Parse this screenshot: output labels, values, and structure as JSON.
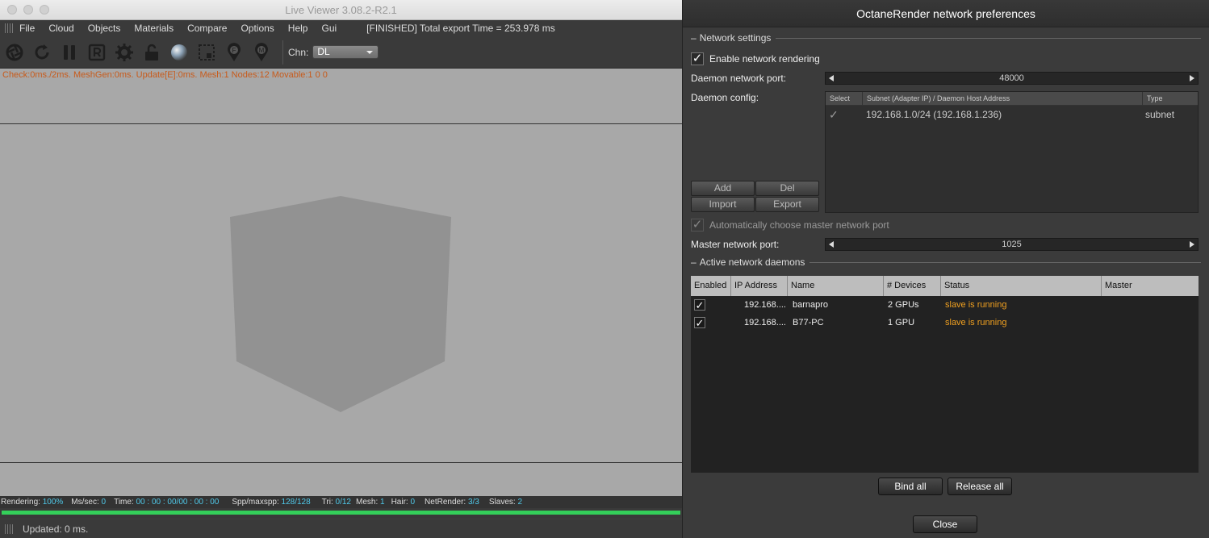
{
  "viewer": {
    "title": "Live Viewer 3.08.2-R2.1",
    "menu": [
      "File",
      "Cloud",
      "Objects",
      "Materials",
      "Compare",
      "Options",
      "Help",
      "Gui"
    ],
    "export_status": "[FINISHED] Total export Time = 253.978 ms",
    "toolbar_icons": [
      "aperture-icon",
      "refresh-icon",
      "pause-icon",
      "r-icon",
      "gear-icon",
      "lock-icon",
      "sphere-icon",
      "region-icon",
      "pin-f-icon",
      "pin-m-icon"
    ],
    "channel_label": "Chn:",
    "channel_value": "DL",
    "stats_line": "Check:0ms./2ms. MeshGen:0ms. Update[E]:0ms. Mesh:1 Nodes:12 Movable:1  0 0",
    "status": {
      "rendering_label": "Rendering:",
      "rendering_value": "100%",
      "mssec_label": "Ms/sec:",
      "mssec_value": "0",
      "time_label": "Time:",
      "time_value": "00 : 00 : 00/00 : 00 : 00",
      "spp_label": "Spp/maxspp:",
      "spp_value": "128/128",
      "tri_label": "Tri:",
      "tri_value": "0/12",
      "mesh_label": "Mesh:",
      "mesh_value": "1",
      "hair_label": "Hair:",
      "hair_value": "0",
      "netrender_label": "NetRender:",
      "netrender_value": "3/3",
      "slaves_label": "Slaves:",
      "slaves_value": "2"
    },
    "progress_fraction": 1.0,
    "updated_text": "Updated: 0 ms.",
    "colors": {
      "render_bg": "#a8a8a8",
      "stats_text": "#c85a1a",
      "status_value": "#4fc8e8",
      "progress": "#34d05a"
    }
  },
  "dialog": {
    "title": "OctaneRender network preferences",
    "network_settings": {
      "heading": "Network settings",
      "enable_label": "Enable network rendering",
      "enable_checked": true,
      "daemon_port_label": "Daemon network port:",
      "daemon_port_value": "48000",
      "daemon_config_label": "Daemon config:",
      "config_table": {
        "headers": [
          "Select",
          "Subnet (Adapter IP) / Daemon Host Address",
          "Type"
        ],
        "rows": [
          {
            "selected": true,
            "subnet": "192.168.1.0/24 (192.168.1.236)",
            "type": "subnet"
          }
        ]
      },
      "buttons": {
        "add": "Add",
        "del": "Del",
        "import": "Import",
        "export": "Export"
      },
      "auto_master_label": "Automatically choose master network port",
      "auto_master_checked": true,
      "master_port_label": "Master network port:",
      "master_port_value": "1025"
    },
    "active_daemons": {
      "heading": "Active network daemons",
      "headers": [
        "Enabled",
        "IP Address",
        "Name",
        "# Devices",
        "Status",
        "Master"
      ],
      "rows": [
        {
          "enabled": true,
          "ip": "192.168....",
          "name": "barnapro",
          "devices": "2 GPUs",
          "status": "slave is running",
          "master": ""
        },
        {
          "enabled": true,
          "ip": "192.168....",
          "name": "B77-PC",
          "devices": "1 GPU",
          "status": "slave is running",
          "master": ""
        }
      ]
    },
    "bind_all": "Bind all",
    "release_all": "Release all",
    "close": "Close",
    "colors": {
      "status_running": "#f0a020",
      "header_bg": "#bdbdbd"
    }
  }
}
